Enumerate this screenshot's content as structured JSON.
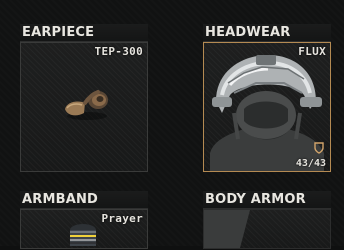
{
  "slots": {
    "earpiece": {
      "title": "EARPIECE",
      "item_name": "TEP-300"
    },
    "headwear": {
      "title": "HEADWEAR",
      "item_name": "FLUX",
      "durability": "43/43"
    },
    "armband": {
      "title": "ARMBAND",
      "item_name": "Prayer"
    },
    "body_armor": {
      "title": "BODY ARMOR"
    }
  },
  "colors": {
    "selected_border": "#b48a52",
    "slot_border": "#3a3b3a",
    "armor_icon": "#d2a46a"
  },
  "icons": {
    "earpiece": "earpiece-icon",
    "headwear": "helmet-icon",
    "armband": "armband-icon",
    "durability": "armor-shield-icon"
  }
}
